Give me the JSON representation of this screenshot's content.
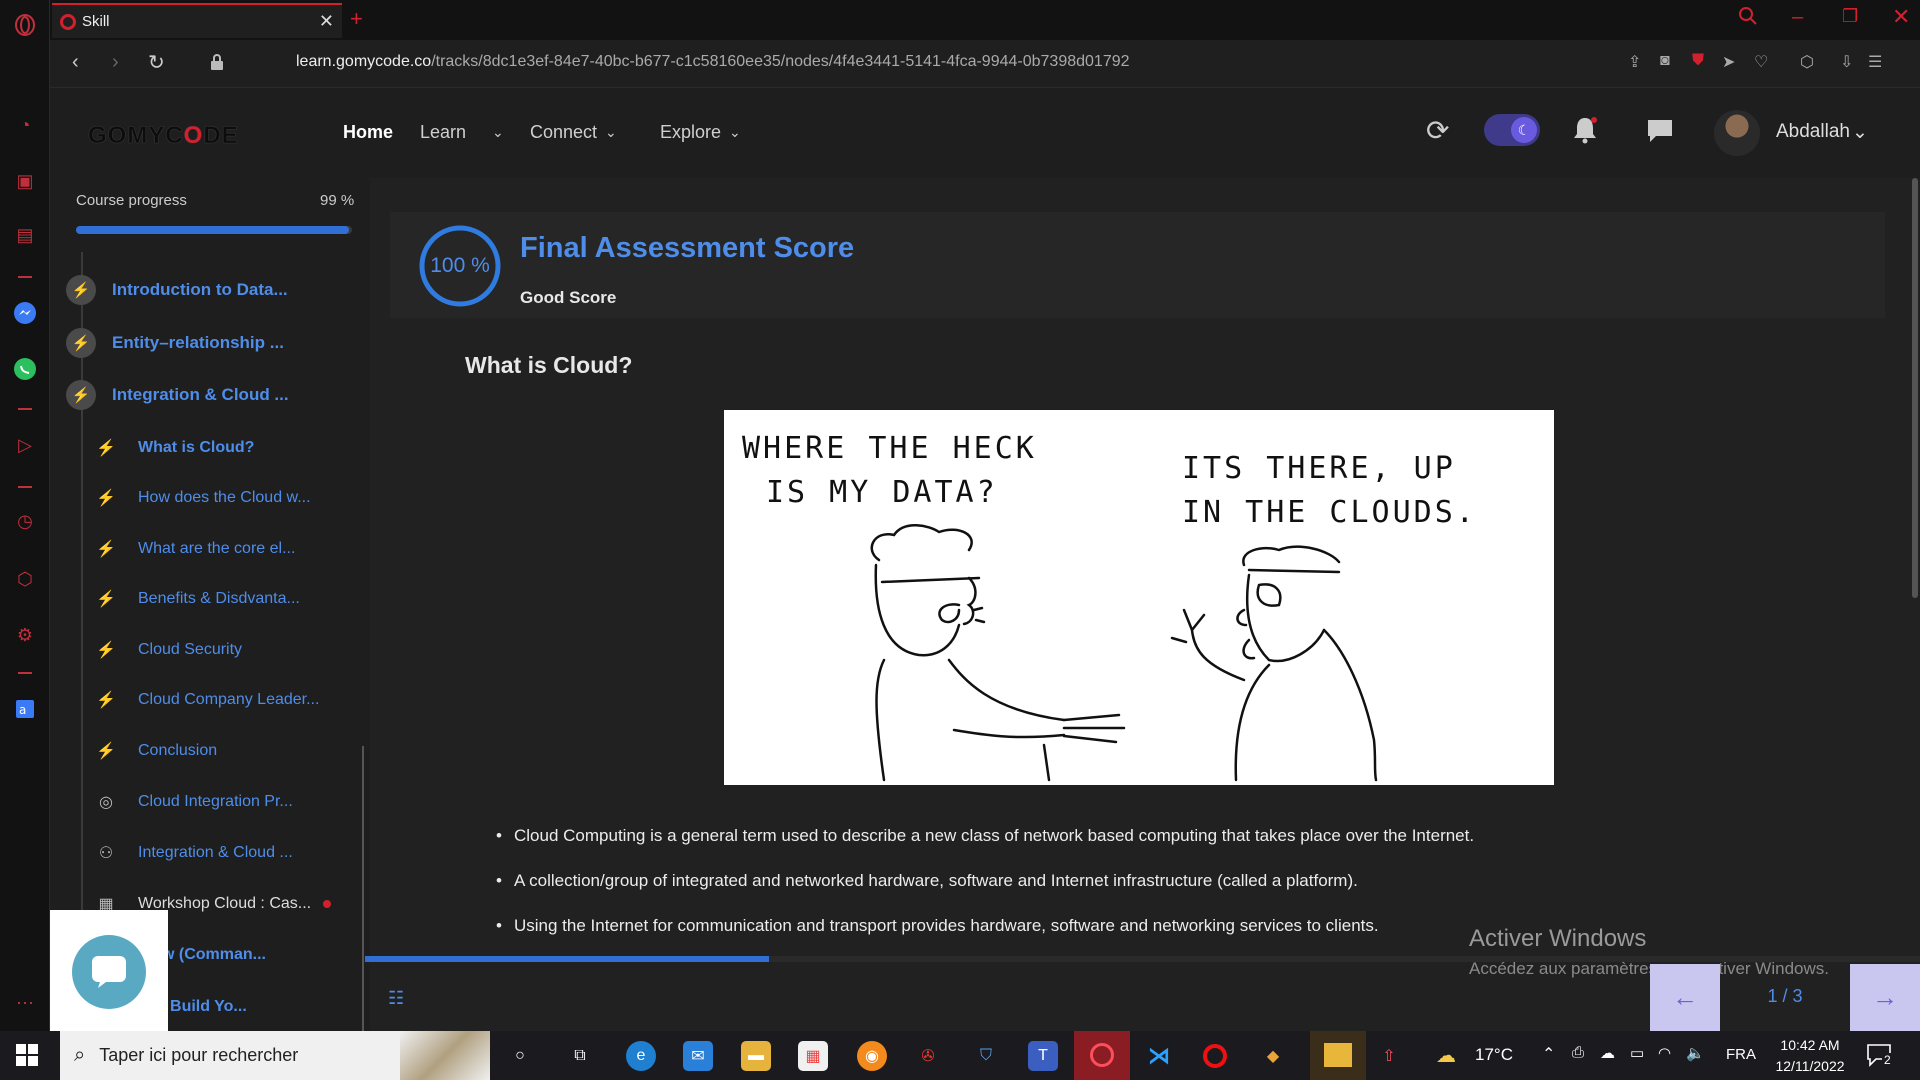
{
  "browser": {
    "tab_title": "Skill",
    "url_host": "learn.gomycode.co",
    "url_path": "/tracks/8dc1e3ef-84e7-40bc-b677-c1c58160ee35/nodes/4f4e3441-5141-4fca-9944-0b7398d01792",
    "accent_color": "#d2202f"
  },
  "header": {
    "logo": "GOMYCODE",
    "nav": [
      {
        "label": "Home",
        "active": true
      },
      {
        "label": "Learn",
        "active": false
      },
      {
        "label": "Connect",
        "active": false
      },
      {
        "label": "Explore",
        "active": false
      }
    ],
    "username": "Abdallah"
  },
  "sidebar": {
    "progress_label": "Course progress",
    "progress_value": "99 %",
    "progress_fraction": 0.99,
    "modules": [
      {
        "label": "Introduction to Data...",
        "icon": "bolt-icon"
      },
      {
        "label": "Entity–relationship ...",
        "icon": "bolt-icon"
      },
      {
        "label": "Integration & Cloud ...",
        "icon": "bolt-icon"
      }
    ],
    "lessons": [
      {
        "label": "What is Cloud?",
        "icon": "bolt-icon",
        "active": true
      },
      {
        "label": "How does the Cloud w...",
        "icon": "bolt-icon"
      },
      {
        "label": "What are the core el...",
        "icon": "bolt-icon"
      },
      {
        "label": "Benefits & Disdvanta...",
        "icon": "bolt-icon"
      },
      {
        "label": "Cloud Security",
        "icon": "bolt-icon"
      },
      {
        "label": "Cloud Company Leader...",
        "icon": "bolt-icon"
      },
      {
        "label": "Conclusion",
        "icon": "bolt-icon"
      },
      {
        "label": "Cloud Integration Pr...",
        "icon": "target-icon"
      },
      {
        "label": "Integration & Cloud ...",
        "icon": "people-icon"
      },
      {
        "label": "Workshop Cloud : Cas...",
        "icon": "grid-icon"
      },
      {
        "label": "Flow (Comman...",
        "icon": "bolt-icon"
      },
      {
        "label": "se : Build Yo...",
        "icon": "bolt-icon"
      }
    ]
  },
  "assessment": {
    "score": "100 %",
    "title": "Final Assessment Score",
    "subtitle": "Good Score"
  },
  "lesson": {
    "heading": "What is Cloud?",
    "comic": {
      "left_text_1": "WHERE THE HECK",
      "left_text_2": "IS MY DATA?",
      "right_text_1": "ITS THERE, UP",
      "right_text_2": "IN THE CLOUDS."
    },
    "bullets": [
      "Cloud Computing is a general term used to describe a new class of network based computing that takes place over the Internet.",
      "A collection/group of integrated and networked hardware, software and Internet infrastructure (called a platform).",
      "Using the Internet for communication and transport provides hardware, software and networking services to clients."
    ],
    "page_indicator": "1 / 3",
    "reading_progress": 0.26
  },
  "watermark": {
    "title": "Activer Windows",
    "subtitle": "Accédez aux paramètres pour activer Windows."
  },
  "taskbar": {
    "search_placeholder": "Taper ici pour rechercher",
    "weather": "17°C",
    "lang": "FRA",
    "time": "10:42 AM",
    "date": "12/11/2022",
    "notification_count": "2"
  }
}
